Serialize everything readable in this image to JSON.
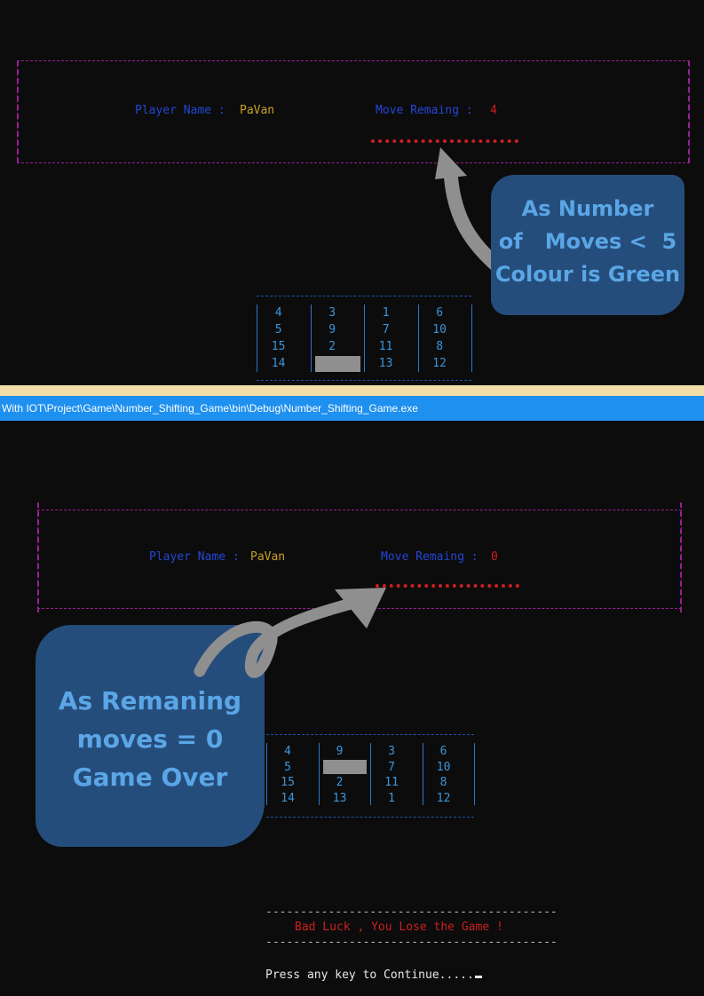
{
  "window": {
    "title": "With IOT\\Project\\Game\\Number_Shifting_Game\\bin\\Debug\\Number_Shifting_Game.exe"
  },
  "top_screen": {
    "player_label": "Player Name : ",
    "player_name": "PaVan",
    "moves_label": "Move Remaing : ",
    "moves_value": "4",
    "grid": [
      [
        "4",
        "3",
        "1",
        "6"
      ],
      [
        "5",
        "9",
        "7",
        "10"
      ],
      [
        "15",
        "2",
        "11",
        "8"
      ],
      [
        "14",
        "",
        "13",
        "12"
      ]
    ],
    "callout": [
      "As Number",
      "of   Moves <  5",
      "Colour is Green"
    ]
  },
  "bottom_screen": {
    "player_label": "Player Name : ",
    "player_name": "PaVan",
    "moves_label": "Move Remaing : ",
    "moves_value": "0",
    "grid": [
      [
        "4",
        "9",
        "3",
        "6"
      ],
      [
        "5",
        "",
        "7",
        "10"
      ],
      [
        "15",
        "2",
        "11",
        "8"
      ],
      [
        "14",
        "13",
        "1",
        "12"
      ]
    ],
    "callout": [
      "As Remaning",
      "moves = 0",
      "Game Over"
    ],
    "dash_line": "------------------------------------------",
    "lose_message": "Bad Luck , You Lose the Game !",
    "press_key": "Press any key to Continue....."
  },
  "colors": {
    "frame": "#9b1f95",
    "label_blue": "#2446d6",
    "name_yellow": "#c8a026",
    "value_red": "#cc1f1f",
    "grid_text": "#3a96dd",
    "callout_bg": "#254d7c",
    "callout_text": "#5aa6e6",
    "titlebar": "#1e90ef"
  },
  "icons": {
    "top_arrow": "curved-arrow-up-icon",
    "bottom_arrow": "curly-arrow-icon"
  }
}
